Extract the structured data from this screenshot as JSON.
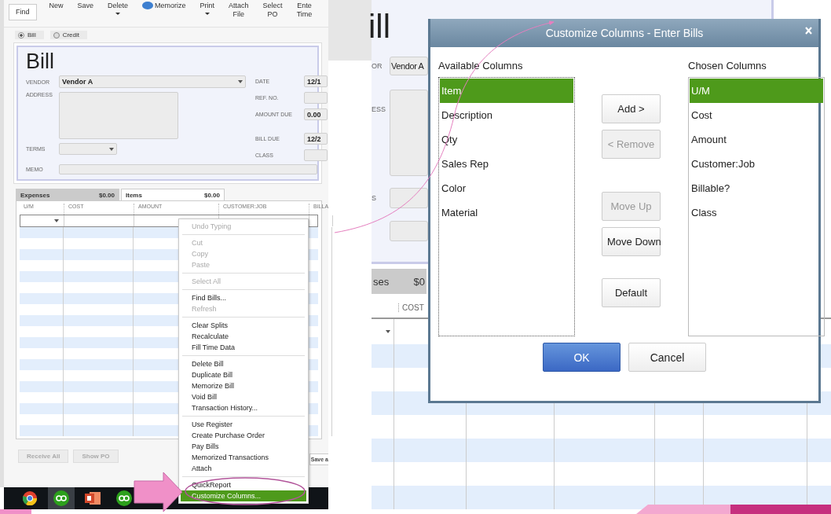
{
  "left_window": {
    "toolbar": [
      {
        "kind": "plain",
        "lines": [
          "Find"
        ]
      },
      {
        "kind": "tool",
        "lines": [
          "New"
        ]
      },
      {
        "kind": "tool",
        "lines": [
          "Save"
        ]
      },
      {
        "kind": "menu",
        "lines": [
          "Delete"
        ]
      },
      {
        "kind": "icon",
        "lines": [
          "Memorize"
        ]
      },
      {
        "kind": "menu",
        "lines": [
          "Print"
        ]
      },
      {
        "kind": "tool",
        "lines": [
          "Attach",
          "File"
        ]
      },
      {
        "kind": "tool",
        "lines": [
          "Select",
          "PO"
        ]
      },
      {
        "kind": "tool",
        "lines": [
          "Ente",
          "Time"
        ]
      }
    ],
    "bill_type": [
      {
        "label": "Bill",
        "selected": true
      },
      {
        "label": "Credit",
        "selected": false
      }
    ],
    "form": {
      "title": "Bill",
      "vendor": {
        "label": "VENDOR",
        "value": "Vendor A"
      },
      "address": {
        "label": "ADDRESS"
      },
      "terms": {
        "label": "TERMS"
      },
      "memo": {
        "label": "MEMO"
      },
      "right_fields": [
        {
          "label": "DATE",
          "value": "12/1"
        },
        {
          "label": "REF. NO."
        },
        {
          "label": "AMOUNT DUE",
          "value": "0.00"
        },
        {
          "label": "BILL DUE",
          "value": "12/2"
        },
        {
          "label": "CLASS"
        }
      ]
    },
    "tabs": [
      {
        "label": "Expenses",
        "amount": "$0.00",
        "selected": false
      },
      {
        "label": "Items",
        "amount": "$0.00",
        "selected": true
      }
    ],
    "columns": [
      "U/M",
      "COST",
      "AMOUNT",
      "CUSTOMER:JOB",
      "BILLA"
    ],
    "bottom_buttons": [
      "Receive All",
      "Show PO"
    ],
    "save_button": "Save a",
    "context_menu": [
      [
        {
          "label": "Undo Typing",
          "disabled": true,
          "selected": false
        }
      ],
      [
        {
          "label": "Cut",
          "disabled": true,
          "selected": false
        },
        {
          "label": "Copy",
          "disabled": true,
          "selected": false
        },
        {
          "label": "Paste",
          "disabled": true,
          "selected": false
        }
      ],
      [
        {
          "label": "Select All",
          "disabled": true,
          "selected": false
        }
      ],
      [
        {
          "label": "Find Bills...",
          "disabled": false,
          "selected": false
        },
        {
          "label": "Refresh",
          "disabled": true,
          "selected": false
        }
      ],
      [
        {
          "label": "Clear Splits",
          "disabled": false,
          "selected": false
        },
        {
          "label": "Recalculate",
          "disabled": false,
          "selected": false
        },
        {
          "label": "Fill Time Data",
          "disabled": false,
          "selected": false
        }
      ],
      [
        {
          "label": "Delete Bill",
          "disabled": false,
          "selected": false
        },
        {
          "label": "Duplicate Bill",
          "disabled": false,
          "selected": false
        },
        {
          "label": "Memorize Bill",
          "disabled": false,
          "selected": false
        },
        {
          "label": "Void Bill",
          "disabled": false,
          "selected": false
        },
        {
          "label": "Transaction History...",
          "disabled": false,
          "selected": false
        }
      ],
      [
        {
          "label": "Use Register",
          "disabled": false,
          "selected": false
        },
        {
          "label": "Create Purchase Order",
          "disabled": false,
          "selected": false
        },
        {
          "label": "Pay Bills",
          "disabled": false,
          "selected": false
        },
        {
          "label": "Memorized Transactions",
          "disabled": false,
          "selected": false
        },
        {
          "label": "Attach",
          "disabled": false,
          "selected": false
        }
      ],
      [
        {
          "label": "QuickReport",
          "disabled": false,
          "selected": false
        },
        {
          "label": "Customize Columns...",
          "disabled": false,
          "selected": true
        }
      ]
    ],
    "taskbar": [
      {
        "kind": "browser",
        "selected": false
      },
      {
        "kind": "books",
        "selected": true
      },
      {
        "kind": "slides",
        "selected": false
      },
      {
        "kind": "books",
        "selected": false
      }
    ]
  },
  "right_window": {
    "title": "ill",
    "vendor_label": "OR",
    "vendor": "Vendor A",
    "address_label": "ESS",
    "terms_label": "S",
    "tab_label": "ses",
    "tab_amount": "$0",
    "column": "COST"
  },
  "dialog": {
    "title": "Customize Columns - Enter Bills",
    "available": {
      "label": "Available Columns",
      "items": [
        {
          "label": "Item",
          "selected": true
        },
        {
          "label": "Description",
          "selected": false
        },
        {
          "label": "Qty",
          "selected": false
        },
        {
          "label": "Sales Rep",
          "selected": false
        },
        {
          "label": "Color",
          "selected": false
        },
        {
          "label": "Material",
          "selected": false
        }
      ]
    },
    "chosen": {
      "label": "Chosen Columns",
      "items": [
        {
          "label": "U/M",
          "selected": true
        },
        {
          "label": "Cost",
          "selected": false
        },
        {
          "label": "Amount",
          "selected": false
        },
        {
          "label": "Customer:Job",
          "selected": false
        },
        {
          "label": "Billable?",
          "selected": false
        },
        {
          "label": "Class",
          "selected": false
        }
      ]
    },
    "side_buttons": [
      {
        "label": "Add >",
        "disabled": false
      },
      {
        "label": "< Remove",
        "disabled": true
      },
      {
        "label": "Move Up",
        "disabled": true
      },
      {
        "label": "Move Down",
        "disabled": false
      },
      {
        "label": "Default",
        "disabled": false
      }
    ],
    "footer_buttons": [
      {
        "label": "OK",
        "kind": "primary"
      },
      {
        "label": "Cancel",
        "kind": "secondary"
      }
    ]
  }
}
